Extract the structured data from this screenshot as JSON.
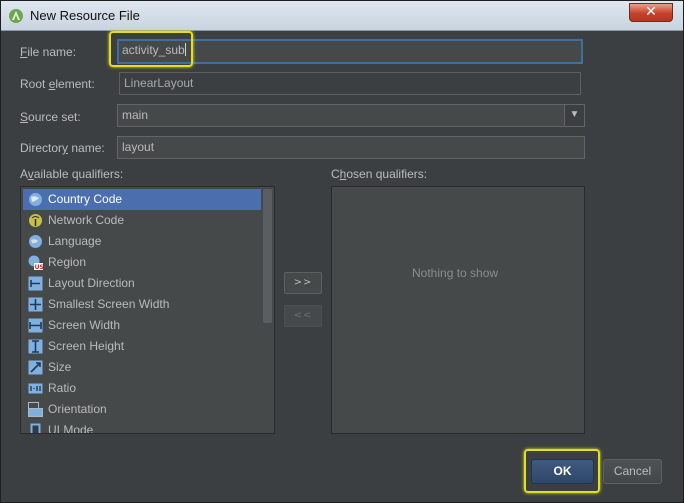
{
  "window": {
    "title": "New Resource File",
    "close_label": "✕"
  },
  "form": {
    "file_name_label": "ile name:",
    "file_name_mnemonic": "F",
    "file_name_value": "activity_sub",
    "root_element_label_pre": "Root ",
    "root_element_mnemonic": "e",
    "root_element_label_post": "lement:",
    "root_element_value": "LinearLayout",
    "source_set_label": "ource set:",
    "source_set_mnemonic": "S",
    "source_set_value": "main",
    "directory_label_pre": "Director",
    "directory_mnemonic": "y",
    "directory_label_post": " name:",
    "directory_value": "layout"
  },
  "available": {
    "label_pre": "A",
    "label_mnemonic": "v",
    "label_post": "ailable qualifiers:",
    "items": [
      {
        "label": "Country Code",
        "icon": "country-code-icon"
      },
      {
        "label": "Network Code",
        "icon": "network-code-icon"
      },
      {
        "label": "Language",
        "icon": "language-icon"
      },
      {
        "label": "Region",
        "icon": "region-icon"
      },
      {
        "label": "Layout Direction",
        "icon": "layout-direction-icon"
      },
      {
        "label": "Smallest Screen Width",
        "icon": "smallest-screen-width-icon"
      },
      {
        "label": "Screen Width",
        "icon": "screen-width-icon"
      },
      {
        "label": "Screen Height",
        "icon": "screen-height-icon"
      },
      {
        "label": "Size",
        "icon": "size-icon"
      },
      {
        "label": "Ratio",
        "icon": "ratio-icon"
      },
      {
        "label": "Orientation",
        "icon": "orientation-icon"
      },
      {
        "label": "UI Mode",
        "icon": "ui-mode-icon"
      }
    ],
    "region_badge": "US"
  },
  "chosen": {
    "label_pre": "C",
    "label_mnemonic": "h",
    "label_post": "osen qualifiers:",
    "empty_text": "Nothing to show"
  },
  "move": {
    "add_label": ">>",
    "remove_label": "<<"
  },
  "buttons": {
    "ok_label": "OK",
    "cancel_label": "Cancel"
  },
  "colors": {
    "accent_selection": "#4b6eaf",
    "highlight": "#e0e020",
    "background": "#3c3f41"
  }
}
